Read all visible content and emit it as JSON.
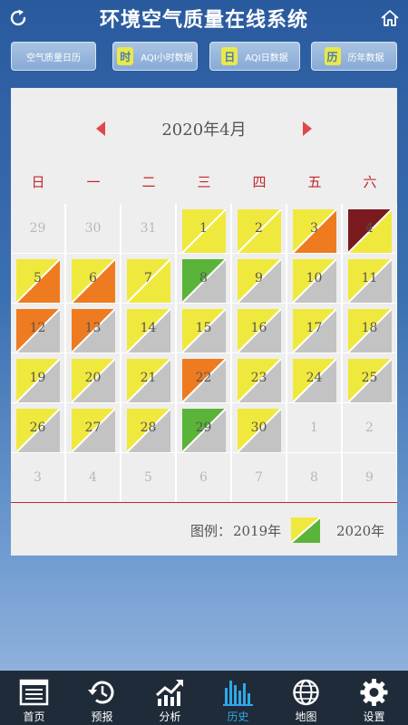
{
  "header": {
    "title": "环境空气质量在线系统"
  },
  "nav": {
    "buttons": [
      {
        "label": "空气质量日历",
        "icon_text": ""
      },
      {
        "label": "AQI小时数据",
        "icon_text": "时"
      },
      {
        "label": "AQI日数据",
        "icon_text": "日"
      },
      {
        "label": "历年数据",
        "icon_text": "历"
      }
    ]
  },
  "calendar": {
    "month_label": "2020年4月",
    "weekdays": [
      "日",
      "一",
      "二",
      "三",
      "四",
      "五",
      "六"
    ],
    "colors": {
      "yellow": "#f0e93d",
      "orange": "#ee7b1f",
      "gray": "#c3c3c3",
      "green": "#5ab43a",
      "maroon": "#7a1a1f"
    },
    "days": [
      {
        "n": "29",
        "dim": true
      },
      {
        "n": "30",
        "dim": true
      },
      {
        "n": "31",
        "dim": true
      },
      {
        "n": "1",
        "y2019": "yellow",
        "y2020": "yellow"
      },
      {
        "n": "2",
        "y2019": "yellow",
        "y2020": "yellow"
      },
      {
        "n": "3",
        "y2019": "yellow",
        "y2020": "orange"
      },
      {
        "n": "4",
        "y2019": "maroon",
        "y2020": "yellow"
      },
      {
        "n": "5",
        "y2019": "yellow",
        "y2020": "orange"
      },
      {
        "n": "6",
        "y2019": "yellow",
        "y2020": "orange"
      },
      {
        "n": "7",
        "y2019": "yellow",
        "y2020": "yellow"
      },
      {
        "n": "8",
        "y2019": "green",
        "y2020": "gray"
      },
      {
        "n": "9",
        "y2019": "yellow",
        "y2020": "gray"
      },
      {
        "n": "10",
        "y2019": "yellow",
        "y2020": "gray"
      },
      {
        "n": "11",
        "y2019": "yellow",
        "y2020": "gray"
      },
      {
        "n": "12",
        "y2019": "orange",
        "y2020": "gray"
      },
      {
        "n": "13",
        "y2019": "orange",
        "y2020": "gray"
      },
      {
        "n": "14",
        "y2019": "yellow",
        "y2020": "gray"
      },
      {
        "n": "15",
        "y2019": "yellow",
        "y2020": "gray"
      },
      {
        "n": "16",
        "y2019": "yellow",
        "y2020": "gray"
      },
      {
        "n": "17",
        "y2019": "yellow",
        "y2020": "gray"
      },
      {
        "n": "18",
        "y2019": "yellow",
        "y2020": "gray"
      },
      {
        "n": "19",
        "y2019": "yellow",
        "y2020": "gray"
      },
      {
        "n": "20",
        "y2019": "yellow",
        "y2020": "gray"
      },
      {
        "n": "21",
        "y2019": "yellow",
        "y2020": "gray"
      },
      {
        "n": "22",
        "y2019": "orange",
        "y2020": "gray"
      },
      {
        "n": "23",
        "y2019": "yellow",
        "y2020": "gray"
      },
      {
        "n": "24",
        "y2019": "yellow",
        "y2020": "gray"
      },
      {
        "n": "25",
        "y2019": "yellow",
        "y2020": "gray"
      },
      {
        "n": "26",
        "y2019": "yellow",
        "y2020": "gray"
      },
      {
        "n": "27",
        "y2019": "yellow",
        "y2020": "gray"
      },
      {
        "n": "28",
        "y2019": "yellow",
        "y2020": "gray"
      },
      {
        "n": "29",
        "y2019": "green",
        "y2020": "gray"
      },
      {
        "n": "30",
        "y2019": "yellow",
        "y2020": "gray"
      },
      {
        "n": "1",
        "dim": true
      },
      {
        "n": "2",
        "dim": true
      },
      {
        "n": "3",
        "dim": true
      },
      {
        "n": "4",
        "dim": true
      },
      {
        "n": "5",
        "dim": true
      },
      {
        "n": "6",
        "dim": true
      },
      {
        "n": "7",
        "dim": true
      },
      {
        "n": "8",
        "dim": true
      },
      {
        "n": "9",
        "dim": true
      }
    ]
  },
  "legend": {
    "prefix": "图例：",
    "year_a": "2019年",
    "year_b": "2020年",
    "color_a": "yellow",
    "color_b": "green"
  },
  "tabbar": {
    "active": 3,
    "tabs": [
      {
        "label": "首页",
        "icon": "newspaper-icon"
      },
      {
        "label": "预报",
        "icon": "history-clock-icon"
      },
      {
        "label": "分析",
        "icon": "trend-chart-icon"
      },
      {
        "label": "历史",
        "icon": "bar-chart-icon"
      },
      {
        "label": "地图",
        "icon": "globe-icon"
      },
      {
        "label": "设置",
        "icon": "gear-icon"
      }
    ]
  }
}
